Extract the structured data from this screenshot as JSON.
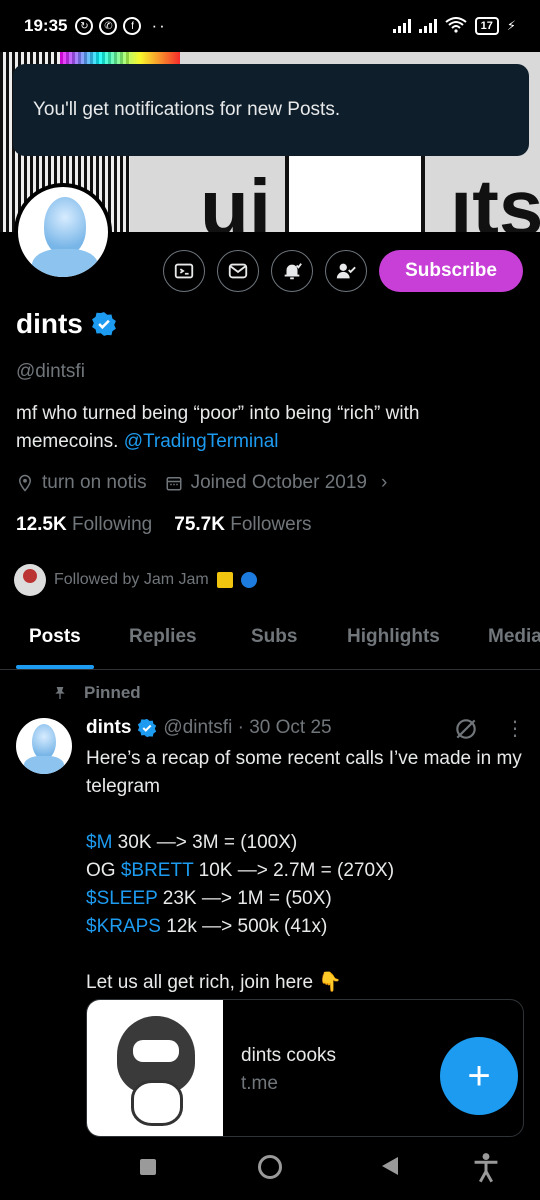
{
  "status_bar": {
    "time": "19:35",
    "battery": "17",
    "network": "4G"
  },
  "toast": {
    "message": "You'll get notifications for new Posts."
  },
  "profile": {
    "name": "dints",
    "handle": "@dintsfi",
    "bio_text": "mf who turned being “poor” into being “rich” with memecoins.",
    "bio_link": "@TradingTerminal",
    "location": "turn on notis",
    "joined": "Joined October 2019",
    "following_count": "12.5K",
    "following_label": "Following",
    "followers_count": "75.7K",
    "followers_label": "Followers",
    "followed_by": "Followed by Jam Jam",
    "subscribe_label": "Subscribe",
    "verified_color": "#1d9bf0",
    "subscribe_color": "#c73fd6"
  },
  "actions": {
    "icons": [
      "grok-icon",
      "message-icon",
      "notifications-on-icon",
      "following-icon"
    ]
  },
  "tabs": [
    {
      "label": "Posts",
      "active": true
    },
    {
      "label": "Replies",
      "active": false
    },
    {
      "label": "Subs",
      "active": false
    },
    {
      "label": "Highlights",
      "active": false
    },
    {
      "label": "Media",
      "active": false
    }
  ],
  "pinned_post": {
    "pinned_label": "Pinned",
    "author": "dints",
    "handle_date": "@dintsfi · 30 Oct 25",
    "intro": "Here’s a recap of some recent calls I’ve made in my telegram",
    "calls": [
      {
        "prefix": "",
        "ticker": "$M",
        "rest": " 30K —> 3M = (100X)"
      },
      {
        "prefix": "OG ",
        "ticker": "$BRETT",
        "rest": " 10K —> 2.7M = (270X)"
      },
      {
        "prefix": "",
        "ticker": "$SLEEP",
        "rest": " 23K —> 1M = (50X)"
      },
      {
        "prefix": "",
        "ticker": "$KRAPS",
        "rest": " 12k —> 500k (41x)"
      }
    ],
    "outro": "Let us all get rich, join here 👇",
    "card_title": "dints cooks",
    "card_domain": "t.me"
  },
  "fab": {
    "label": "+"
  }
}
